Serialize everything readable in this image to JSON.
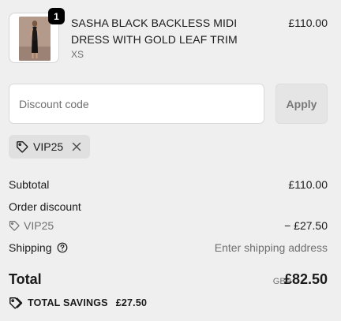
{
  "product": {
    "quantity": "1",
    "name": "SASHA BLACK BACKLESS MIDI DRESS WITH GOLD LEAF TRIM",
    "variant": "XS",
    "price": "£110.00"
  },
  "discount": {
    "placeholder": "Discount code",
    "value": "",
    "apply_label": "Apply",
    "applied_code": "VIP25"
  },
  "summary": {
    "subtotal_label": "Subtotal",
    "subtotal_value": "£110.00",
    "order_discount_label": "Order discount",
    "discount_code": "VIP25",
    "discount_value": "− £27.50",
    "shipping_label": "Shipping",
    "shipping_value": "Enter shipping address"
  },
  "total": {
    "label": "Total",
    "currency": "GBP",
    "amount": "£82.50"
  },
  "savings": {
    "label": "TOTAL SAVINGS",
    "amount": "£27.50"
  },
  "icons": {
    "tag": "tag-icon",
    "remove": "close-icon",
    "help": "question-circle-icon"
  },
  "colors": {
    "background": "#efefef",
    "badge": "#000000",
    "muted_text": "#707070",
    "chip": "#e0e0e0",
    "apply_button": "#e5e5e5"
  }
}
